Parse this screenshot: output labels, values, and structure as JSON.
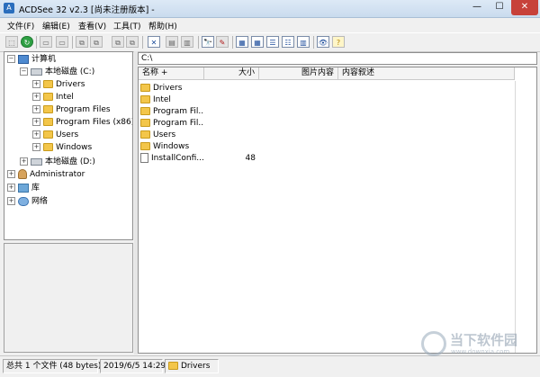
{
  "window": {
    "title": "ACDSee 32 v2.3 [尚未注册版本] -",
    "min": "—",
    "max": "☐",
    "close": "✕"
  },
  "menu": [
    "文件(F)",
    "编辑(E)",
    "查看(V)",
    "工具(T)",
    "帮助(H)"
  ],
  "toolbar": {
    "buttons": [
      {
        "name": "up-folder-icon",
        "glyph": "⬚"
      },
      {
        "name": "refresh-icon",
        "glyph": "↻"
      },
      {
        "name": "browse-icon",
        "glyph": "▭"
      },
      {
        "name": "view-icon",
        "glyph": "▭"
      },
      {
        "name": "copy-icon",
        "glyph": "⧉"
      },
      {
        "name": "paste-icon",
        "glyph": "⧉"
      },
      {
        "name": "delete-icon",
        "glyph": "✕"
      },
      {
        "name": "properties-icon",
        "glyph": "▤"
      },
      {
        "name": "document-icon",
        "glyph": "▥"
      },
      {
        "name": "find-icon",
        "glyph": "🔭"
      },
      {
        "name": "tools-icon",
        "glyph": "✎"
      },
      {
        "name": "large-icons-icon",
        "glyph": "▦"
      },
      {
        "name": "small-icons-icon",
        "glyph": "▦"
      },
      {
        "name": "list-view-icon",
        "glyph": "☰"
      },
      {
        "name": "details-view-icon",
        "glyph": "☷"
      },
      {
        "name": "thumbnails-icon",
        "glyph": "▥"
      },
      {
        "name": "view-image-icon",
        "glyph": "👁"
      },
      {
        "name": "help-icon",
        "glyph": "?"
      }
    ]
  },
  "tree": {
    "computer": "计算机",
    "drive_c": "本地磁盘 (C:)",
    "folders": [
      "Drivers",
      "Intel",
      "Program Files",
      "Program Files (x86)",
      "Users",
      "Windows"
    ],
    "drive_d": "本地磁盘 (D:)",
    "administrator": "Administrator",
    "library": "库",
    "network": "网络",
    "expanded": "−",
    "collapsed": "+"
  },
  "address": "C:\\",
  "columns": [
    "名称 +",
    "大小",
    "图片内容",
    "内容叙述"
  ],
  "files": [
    {
      "name": "Drivers",
      "size": "",
      "type": "folder"
    },
    {
      "name": "Intel",
      "size": "",
      "type": "folder"
    },
    {
      "name": "Program Fil...",
      "size": "",
      "type": "folder"
    },
    {
      "name": "Program Fil...",
      "size": "",
      "type": "folder"
    },
    {
      "name": "Users",
      "size": "",
      "type": "folder"
    },
    {
      "name": "Windows",
      "size": "",
      "type": "folder"
    },
    {
      "name": "InstallConfi...",
      "size": "48",
      "type": "file"
    }
  ],
  "status": {
    "summary": "总共 1 个文件 (48 bytes)",
    "date": "2019/6/5 14:29",
    "folder": "Drivers"
  },
  "watermark": {
    "title": "当下软件园",
    "url": "www.downxia.com"
  }
}
